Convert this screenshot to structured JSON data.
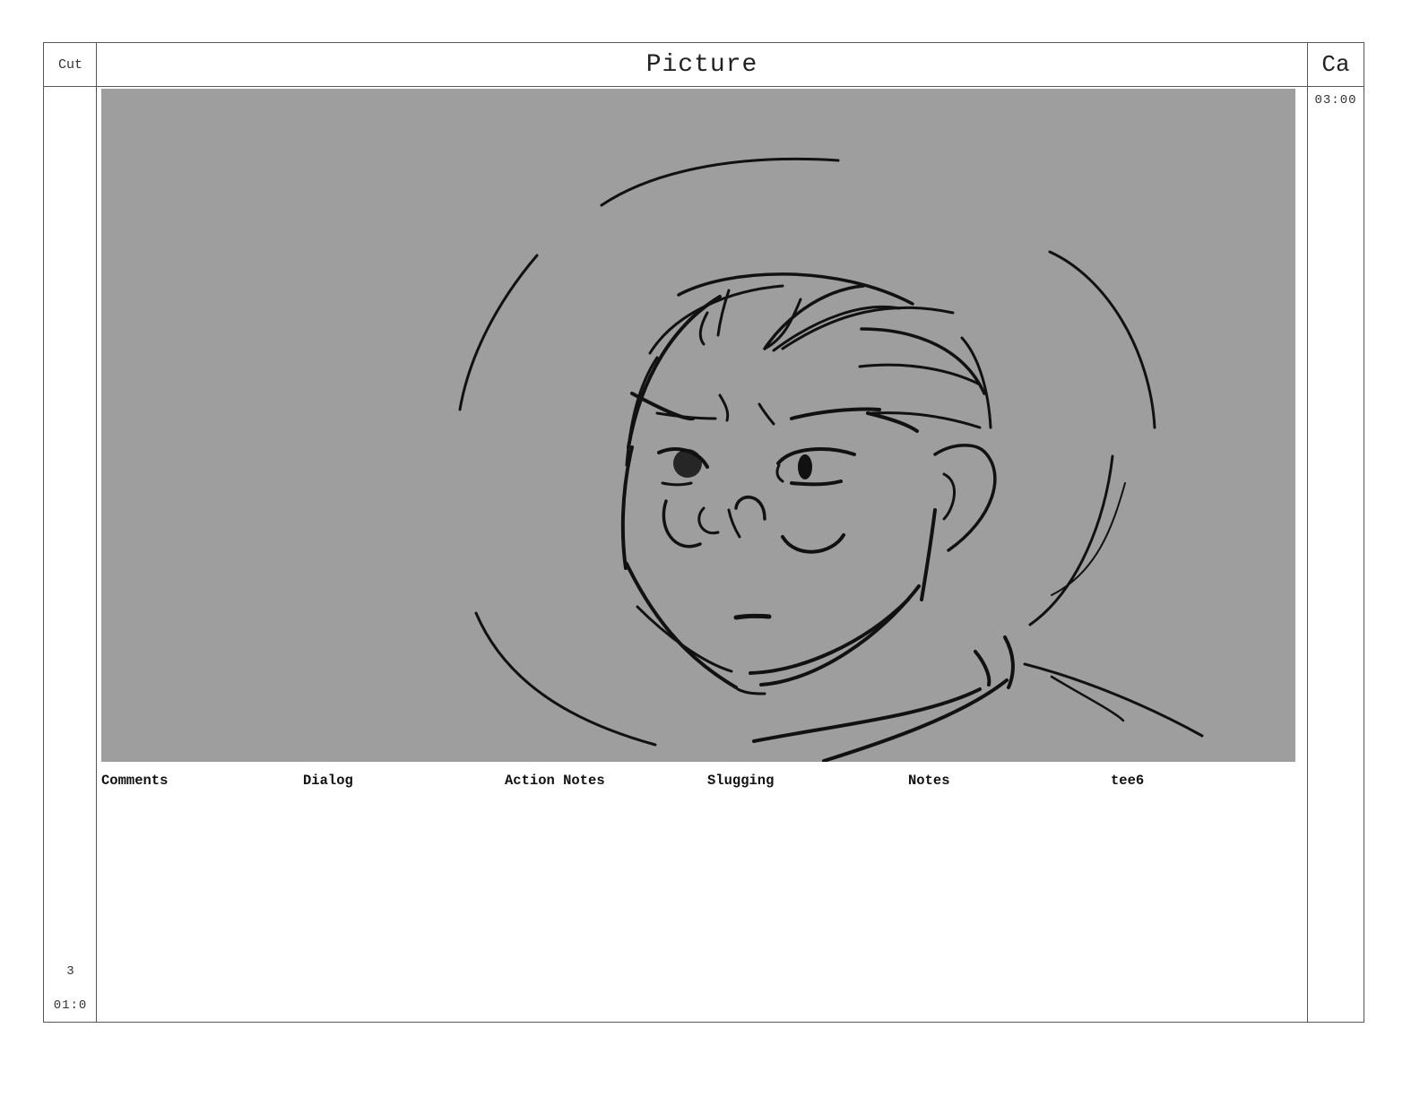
{
  "header": {
    "cut_label": "Cut",
    "picture_label": "Picture",
    "camera_label": "Ca"
  },
  "camera": {
    "time": "03:00"
  },
  "cut": {
    "number": "3",
    "time": "01:0"
  },
  "panel": {
    "background_color": "#9e9e9e",
    "stroke_color": "#111111"
  },
  "fields": [
    "Comments",
    "Dialog",
    "Action Notes",
    "Slugging",
    "Notes",
    "tee6"
  ]
}
